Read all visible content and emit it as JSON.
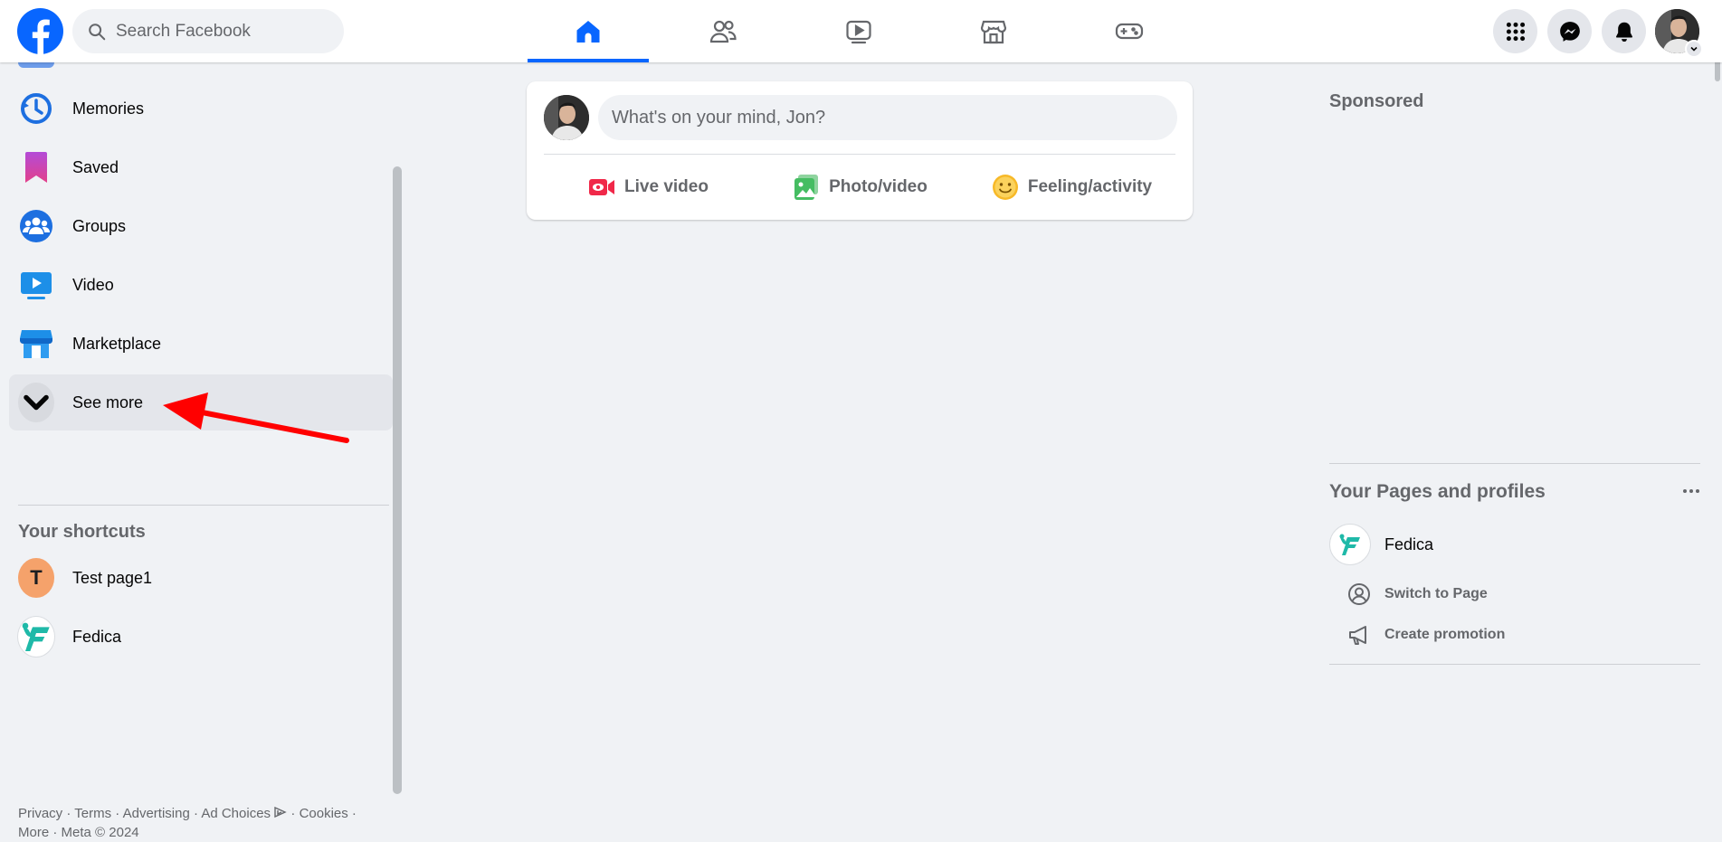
{
  "search": {
    "placeholder": "Search Facebook"
  },
  "nav_tabs": [
    {
      "name": "home",
      "active": true
    },
    {
      "name": "friends",
      "active": false
    },
    {
      "name": "watch",
      "active": false
    },
    {
      "name": "marketplace",
      "active": false
    },
    {
      "name": "gaming",
      "active": false
    }
  ],
  "top_icons": [
    "menu-grid-icon",
    "messenger-icon",
    "notifications-icon",
    "account-avatar"
  ],
  "sidebar": {
    "items": [
      {
        "label": "Memories",
        "icon": "memories-icon"
      },
      {
        "label": "Saved",
        "icon": "saved-icon"
      },
      {
        "label": "Groups",
        "icon": "groups-icon"
      },
      {
        "label": "Video",
        "icon": "video-icon"
      },
      {
        "label": "Marketplace",
        "icon": "marketplace-icon"
      },
      {
        "label": "See more",
        "icon": "chevron-down-icon"
      }
    ],
    "shortcuts_title": "Your shortcuts",
    "shortcuts": [
      {
        "label": "Test page1",
        "initial": "T"
      },
      {
        "label": "Fedica"
      }
    ]
  },
  "footer": {
    "privacy": "Privacy",
    "terms": "Terms",
    "advertising": "Advertising",
    "ad_choices": "Ad Choices",
    "cookies": "Cookies",
    "more": "More",
    "meta": "Meta © 2024",
    "sep": " · "
  },
  "composer": {
    "prompt": "What's on your mind, Jon?",
    "live_video": "Live video",
    "photo_video": "Photo/video",
    "feeling": "Feeling/activity"
  },
  "right": {
    "sponsored": "Sponsored",
    "pages_title": "Your Pages and profiles",
    "page_name": "Fedica",
    "switch_to_page": "Switch to Page",
    "create_promotion": "Create promotion"
  },
  "colors": {
    "brand_blue": "#0866ff",
    "live_red": "#f02849",
    "photo_green": "#45bd62",
    "feeling_yellow": "#f7b928",
    "fedica_teal": "#1fb9a8",
    "annotation_red": "#ff0000"
  }
}
